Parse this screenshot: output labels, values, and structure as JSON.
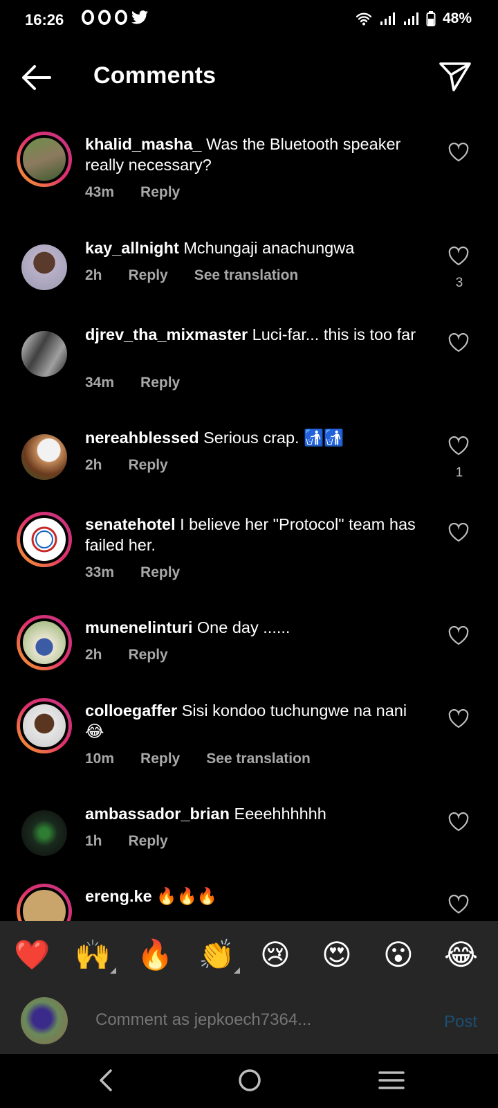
{
  "status_bar": {
    "time": "16:26",
    "battery": "48%"
  },
  "header": {
    "title": "Comments"
  },
  "comments": [
    {
      "username": "khalid_masha_",
      "text": "Was the Bluetooth speaker really necessary?",
      "time": "43m",
      "reply": "Reply"
    },
    {
      "username": "kay_allnight",
      "text": "Mchungaji anachungwa",
      "time": "2h",
      "reply": "Reply",
      "translate": "See translation",
      "likes": "3"
    },
    {
      "username": "djrev_tha_mixmaster",
      "text": "Luci-far... this is too far",
      "time": "34m",
      "reply": "Reply"
    },
    {
      "username": "nereahblessed",
      "text": "Serious crap. 🚮🚮",
      "time": "2h",
      "reply": "Reply",
      "likes": "1"
    },
    {
      "username": "senatehotel",
      "text": "I believe her \"Protocol\" team has failed her.",
      "time": "33m",
      "reply": "Reply"
    },
    {
      "username": "munenelinturi",
      "text": "One day ......",
      "time": "2h",
      "reply": "Reply"
    },
    {
      "username": "colloegaffer",
      "text": "Sisi kondoo tuchungwe na nani😂",
      "time": "10m",
      "reply": "Reply",
      "translate": "See translation"
    },
    {
      "username": "ambassador_brian",
      "text": "Eeeehhhhhh",
      "time": "1h",
      "reply": "Reply"
    },
    {
      "username": "ereng.ke",
      "text": "🔥🔥🔥"
    }
  ],
  "emoji_bar": [
    "❤️",
    "🙌",
    "🔥",
    "👏",
    "😢",
    "😍",
    "😮",
    "😂"
  ],
  "composer": {
    "placeholder": "Comment as jepkoech7364...",
    "post_label": "Post"
  },
  "colors": {
    "accent": "#0095f6",
    "post_disabled": "#1b4f72",
    "secondary_text": "#a8a8a8"
  }
}
